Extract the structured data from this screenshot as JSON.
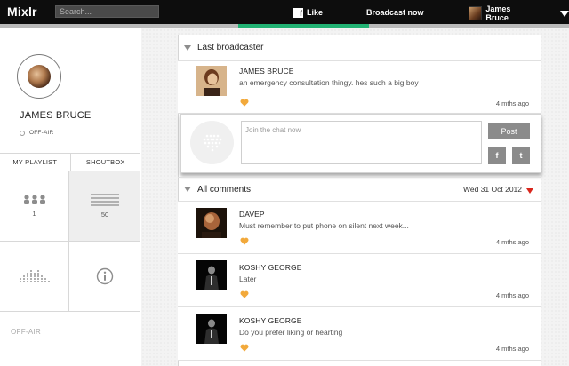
{
  "app": {
    "logo": "Mixlr"
  },
  "topbar": {
    "search_placeholder": "Search...",
    "fb_glyph": "f",
    "fb_like": "Like",
    "broadcast_now": "Broadcast now",
    "user_name": "James Bruce"
  },
  "profile": {
    "name": "JAMES BRUCE",
    "status": "OFF-AIR"
  },
  "sidebar": {
    "tabs": [
      "MY PLAYLIST",
      "SHOUTBOX"
    ],
    "cells": [
      {
        "icon": "people-icon",
        "count": "1"
      },
      {
        "icon": "lines-icon",
        "count": "50"
      },
      {
        "icon": "equalizer-icon",
        "count": ""
      },
      {
        "icon": "info-icon",
        "count": ""
      }
    ],
    "bottom_status": "OFF-AIR"
  },
  "last_broadcaster": {
    "heading": "Last broadcaster",
    "name": "JAMES BRUCE",
    "text": "an emergency consultation thingy. hes such a big boy",
    "time": "4 mths ago"
  },
  "chat": {
    "placeholder": "Join the chat now",
    "post_label": "Post",
    "fb_label": "f",
    "tw_label": "t"
  },
  "comments": {
    "heading": "All comments",
    "date": "Wed 31 Oct 2012",
    "items": [
      {
        "name": "DAVEP",
        "text": "Must remember to put phone on silent next week...",
        "time": "4 mths ago"
      },
      {
        "name": "KOSHY GEORGE",
        "text": "Later",
        "time": "4 mths ago"
      },
      {
        "name": "KOSHY GEORGE",
        "text": "Do you prefer liking or hearting",
        "time": "4 mths ago"
      }
    ]
  },
  "colors": {
    "accent_green": "#21b273",
    "heart": "#f2a93b",
    "alert_red": "#d9261c"
  }
}
